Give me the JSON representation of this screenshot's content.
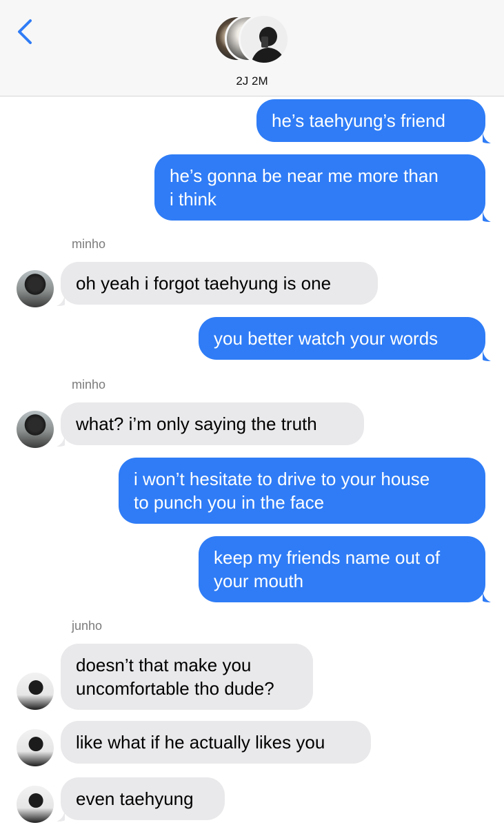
{
  "header": {
    "back_icon": "chevron-left-icon",
    "title": "2J 2M",
    "accent": "#2f7cf6"
  },
  "messages": [
    {
      "dir": "out",
      "text": "he’s taehyung’s friend"
    },
    {
      "dir": "out",
      "text": "he’s gonna be near me more than\ni think"
    },
    {
      "dir": "in",
      "sender": "minho",
      "text": "oh yeah i forgot taehyung is one"
    },
    {
      "dir": "out",
      "text": "you better watch your words"
    },
    {
      "dir": "in",
      "sender": "minho",
      "text": "what? i’m only saying the truth"
    },
    {
      "dir": "out",
      "text": "i won’t hesitate to drive to your house\nto punch you in the face"
    },
    {
      "dir": "out",
      "text": "keep my friends name out of\nyour mouth"
    },
    {
      "dir": "in",
      "sender": "junho",
      "text": "doesn’t that make you\nuncomfortable tho dude?"
    },
    {
      "dir": "in",
      "text": "like what if he actually likes you"
    },
    {
      "dir": "in",
      "text": "even taehyung"
    }
  ],
  "colors": {
    "outgoing": "#2f7cf6",
    "incoming": "#e9e9eb",
    "header_bg": "#f7f7f7"
  }
}
